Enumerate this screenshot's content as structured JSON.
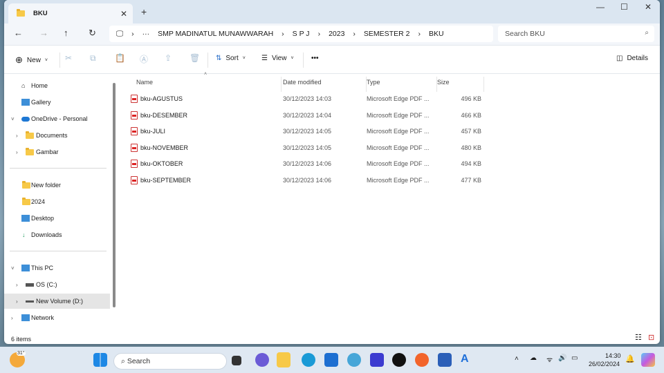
{
  "window": {
    "tab_title": "BKU",
    "search_placeholder": "Search BKU"
  },
  "breadcrumb": [
    "SMP MADINATUL MUNAWWARAH",
    "S P J",
    "2023",
    "SEMESTER 2",
    "BKU"
  ],
  "toolbar": {
    "new": "New",
    "sort": "Sort",
    "view": "View",
    "more": "•••",
    "details": "Details"
  },
  "sidebar": [
    "Home",
    "Gallery",
    "OneDrive - Personal",
    "Documents",
    "Gambar",
    "New folder",
    "2024",
    "Desktop",
    "Downloads",
    "This PC",
    "OS (C:)",
    "New Volume (D:)",
    "Network"
  ],
  "columns": {
    "name": "Name",
    "date": "Date modified",
    "type": "Type",
    "size": "Size"
  },
  "files": [
    {
      "name": "bku-AGUSTUS",
      "date": "30/12/2023 14:03",
      "type": "Microsoft Edge PDF ...",
      "size": "496 KB"
    },
    {
      "name": "bku-DESEMBER",
      "date": "30/12/2023 14:04",
      "type": "Microsoft Edge PDF ...",
      "size": "466 KB"
    },
    {
      "name": "bku-JULI",
      "date": "30/12/2023 14:05",
      "type": "Microsoft Edge PDF ...",
      "size": "457 KB"
    },
    {
      "name": "bku-NOVEMBER",
      "date": "30/12/2023 14:05",
      "type": "Microsoft Edge PDF ...",
      "size": "480 KB"
    },
    {
      "name": "bku-OKTOBER",
      "date": "30/12/2023 14:06",
      "type": "Microsoft Edge PDF ...",
      "size": "494 KB"
    },
    {
      "name": "bku-SEPTEMBER",
      "date": "30/12/2023 14:06",
      "type": "Microsoft Edge PDF ...",
      "size": "477 KB"
    }
  ],
  "status": "6 items",
  "taskbar": {
    "weather": "31°",
    "search": "Search",
    "time": "14:30",
    "date": "26/02/2024"
  }
}
